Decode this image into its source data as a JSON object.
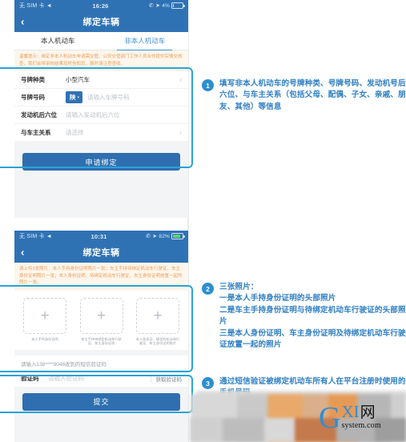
{
  "screen_one": {
    "status_bar": {
      "carrier": "无 SIM 卡",
      "wifi_icon": "wifi-icon",
      "time": "16:26",
      "call_icon": "phone-icon",
      "location_icon": "location-arrow-icon",
      "battery_percent": "4%",
      "battery_color": "#cfe0f1"
    },
    "nav": {
      "back_icon": "chevron-left-icon",
      "title": "绑定车辆"
    },
    "tabs": [
      {
        "label": "本人机动车",
        "active": false
      },
      {
        "label": "非本人机动车",
        "active": true
      }
    ],
    "notice": "温馨提示：绑定非本人机动车申请需交管、公安交管部门工作人员合作提供实情交核查，我们会将审核结果及时告知您，届时请注意查收。",
    "form": {
      "rows": [
        {
          "label": "号牌种类",
          "value": "小型汽车",
          "type": "select",
          "chevron": "chevron-right-icon"
        },
        {
          "label": "号牌号码",
          "plate_prefix": "陕",
          "plate_caret": "▾",
          "placeholder": "请输入车牌号码",
          "type": "plate"
        },
        {
          "label": "发动机后六位",
          "placeholder": "请输入发动机后六位",
          "type": "text"
        },
        {
          "label": "与车主关系",
          "value": "请选择",
          "type": "select",
          "chevron": "chevron-right-icon",
          "muted": true
        }
      ]
    },
    "submit_button": "申请绑定"
  },
  "screen_two": {
    "status_bar": {
      "carrier": "无 SIM 卡",
      "wifi_icon": "wifi-icon",
      "time": "10:31",
      "call_icon": "phone-icon",
      "location_icon": "location-arrow-icon",
      "battery_percent": "82%",
      "battery_color": "#5fd36a"
    },
    "nav": {
      "back_icon": "chevron-left-icon",
      "title": "绑定车辆"
    },
    "notice": "请上传3张照片：本人手持身份证明照片一张；车主手持待绑定机动车行驶证、车主身份证明照片一张；本人身份证明、待绑定机动车行驶证、车主身份证明放置一起的照片一张。",
    "uploads": [
      {
        "add_icon": "plus-icon",
        "caption": "本人手持身份证明"
      },
      {
        "add_icon": "plus-icon",
        "caption": "车主手持待绑定机动车行驶证、车主身份证明"
      },
      {
        "add_icon": "plus-icon",
        "caption": "本人身份证、绑定的机动车行驶证、车主身份证明照片"
      }
    ],
    "sms": {
      "hint": "请输入138****9048收到的短信验证码",
      "label": "验证码",
      "placeholder": "请输入验证码",
      "get_code_button": "获取验证码"
    },
    "submit_button": "提交"
  },
  "annotations": [
    {
      "number": "1",
      "text": "填写非本人机动车的号牌种类、号牌号码、发动机号后六位、与车主关系（包括父母、配偶、子女、亲戚、朋友、其他）等信息"
    },
    {
      "number": "2",
      "text": "三张照片：\n一是本人手持身份证明的头部照片\n二是车主手持身份证明与待绑定机动车行驶证的头部照片\n三是本人身份证明、车主身份证明及待绑定机动车行驶证放置一起的照片"
    },
    {
      "number": "3",
      "text": "通过短信验证被绑定机动车所有人在平台注册时使用的手机号码"
    }
  ],
  "watermark": {
    "letter": "G",
    "top": "XI",
    "cjk": "网",
    "sub": "system.com"
  },
  "colors": {
    "brand_blue": "#2f72b4",
    "accent_blue": "#2aa3d6",
    "annotation_blue": "#2f7fc4",
    "notice_orange": "#e8a05a",
    "button_blue": "#2f6fb0"
  }
}
